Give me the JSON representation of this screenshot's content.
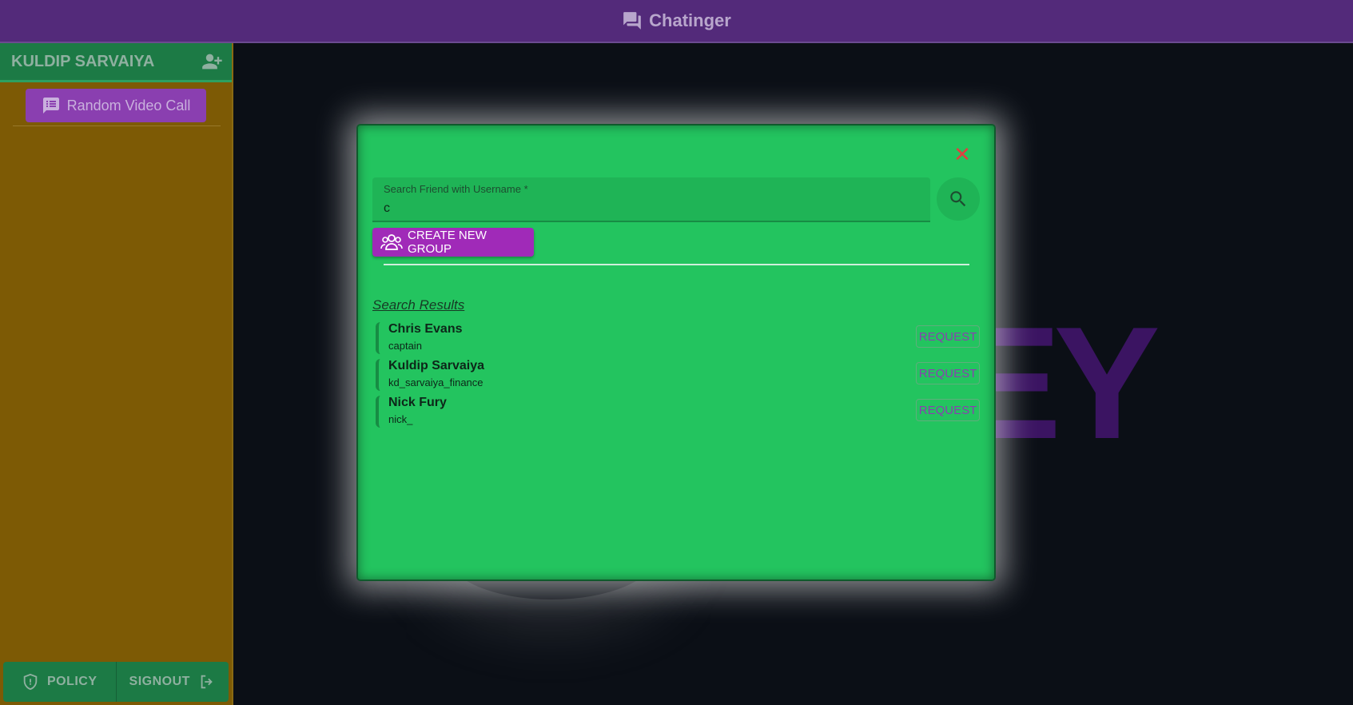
{
  "app": {
    "title": "Chatinger"
  },
  "sidebar": {
    "user_name": "KULDIP SARVAIYA",
    "random_video_call": "Random Video Call",
    "policy_label": "POLICY",
    "signout_label": "SIGNOUT"
  },
  "background": {
    "logo_text": "EY"
  },
  "modal": {
    "close_symbol": "✕",
    "search_label": "Search Friend with Username *",
    "search_value": "c",
    "create_group_label": "CREATE NEW GROUP",
    "results_title": "Search Results",
    "results": [
      {
        "name": "Chris Evans",
        "username": "captain",
        "action": "REQUEST"
      },
      {
        "name": "Kuldip Sarvaiya",
        "username": "kd_sarvaiya_finance",
        "action": "REQUEST"
      },
      {
        "name": "Nick Fury",
        "username": "nick_",
        "action": "REQUEST"
      }
    ]
  },
  "colors": {
    "topbar": "#532a7a",
    "sidebar": "#7d5a05",
    "modal": "#23c45f",
    "accent_purple": "#a02ab8",
    "close_red": "#e04040"
  },
  "icons": {
    "app": "chat-bubbles-icon",
    "add_friend": "person-add-icon",
    "video_call": "chat-bubble-icon",
    "policy": "shield-icon",
    "signout": "logout-icon",
    "search": "search-icon",
    "group": "group-icon",
    "close": "close-icon"
  }
}
